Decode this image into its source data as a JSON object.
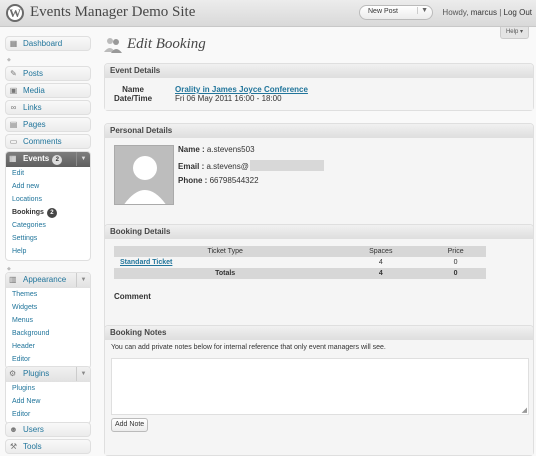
{
  "header": {
    "site_title": "Events Manager Demo Site",
    "new_post": "New Post",
    "howdy_prefix": "Howdy,",
    "username": "marcus",
    "separator": "|",
    "logout": "Log Out",
    "help": "Help"
  },
  "sidebar": {
    "dashboard": "Dashboard",
    "posts": "Posts",
    "media": "Media",
    "links": "Links",
    "pages": "Pages",
    "comments": "Comments",
    "events": {
      "label": "Events",
      "badge": "2"
    },
    "events_sub": [
      "Edit",
      "Add new",
      "Locations",
      "Bookings",
      "Categories",
      "Settings",
      "Help"
    ],
    "bookings_badge": "2",
    "appearance": "Appearance",
    "appearance_sub": [
      "Themes",
      "Widgets",
      "Menus",
      "Background",
      "Header",
      "Editor"
    ],
    "plugins": "Plugins",
    "plugins_sub": [
      "Plugins",
      "Add New",
      "Editor"
    ],
    "users": "Users",
    "tools": "Tools"
  },
  "page": {
    "title": "Edit Booking"
  },
  "event_details": {
    "heading": "Event Details",
    "label_line1": "Name",
    "label_line2": "Date/Time",
    "event_name": "Orality in James Joyce Conference",
    "event_date": "Fri 06 May 2011 16:00 - 18:00"
  },
  "personal_details": {
    "heading": "Personal Details",
    "name_label": "Name :",
    "name_value": "a.stevens503",
    "email_label": "Email :",
    "email_value": "a.stevens@",
    "phone_label": "Phone :",
    "phone_value": "66798544322"
  },
  "booking_details": {
    "heading": "Booking Details",
    "columns": [
      "Ticket Type",
      "Spaces",
      "Price"
    ],
    "rows": [
      {
        "type": "Standard Ticket",
        "spaces": "4",
        "price": "0"
      }
    ],
    "totals": {
      "label": "Totals",
      "spaces": "4",
      "price": "0"
    },
    "comment_label": "Comment"
  },
  "booking_notes": {
    "heading": "Booking Notes",
    "help": "You can add private notes below for internal reference that only event managers will see.",
    "add_button": "Add Note"
  }
}
